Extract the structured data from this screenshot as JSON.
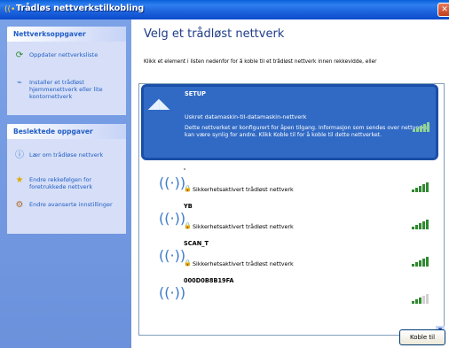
{
  "window": {
    "title": "Trådløs nettverkstilkobling"
  },
  "taskpane": {
    "network_tasks": {
      "header": "Nettverksoppgaver",
      "items": [
        {
          "label": "Oppdater nettverksliste",
          "icon": "refresh-icon"
        },
        {
          "label": "Installer et trådløst hjemmenettverk eller lite kontornettverk",
          "icon": "wireless-setup-icon"
        }
      ]
    },
    "related_tasks": {
      "header": "Beslektede oppgaver",
      "items": [
        {
          "label": "Lær om trådløse nettverk",
          "icon": "info-icon"
        },
        {
          "label": "Endre rekkefølgen for foretrukkede nettverk",
          "icon": "star-icon"
        },
        {
          "label": "Endre avanserte innstillinger",
          "icon": "settings-icon"
        }
      ]
    }
  },
  "main": {
    "heading": "Velg et trådløst nettverk",
    "instruction": "Klikk et element i listen nedenfor for å koble til et trådløst nettverk innen rekkevidde, eller",
    "networks": [
      {
        "name": "SETUP",
        "status": "Uskret datamaskin-til-datamaskin-nettverk",
        "description": "Dette nettverket er konfigurert for åpen tilgang. Informasjon som sendes over nettverket kan være synlig for andre. Klikk Koble til for å koble til dette nettverket.",
        "signal": 1.0,
        "selected": true
      },
      {
        "name": "'",
        "status": "Sikkerhetsaktivert trådløst nettverk",
        "signal": 0.8,
        "secured": true
      },
      {
        "name": "YB",
        "status": "Sikkerhetsaktivert trådløst nettverk",
        "signal": 0.8,
        "secured": true
      },
      {
        "name": "SCAN_T",
        "status": "Sikkerhetsaktivert trådløst nettverk",
        "signal": 0.8,
        "secured": true
      },
      {
        "name": "000D0B8B19FA",
        "status": "",
        "signal": 0.6,
        "secured": true
      }
    ],
    "connect_button": "Koble til"
  },
  "colors": {
    "selected_bg": "#316ac5",
    "taskpane_bg": "#6b91dc",
    "link": "#215dc6",
    "heading": "#1f3c88",
    "signal": "#2f8a2f"
  }
}
